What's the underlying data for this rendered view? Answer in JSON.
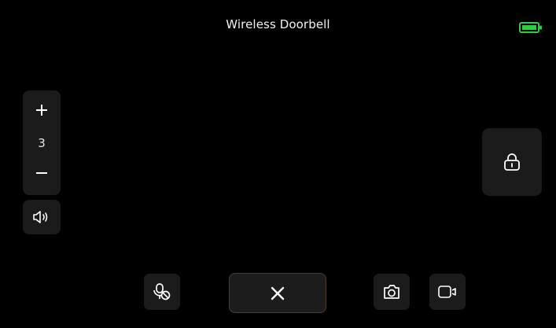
{
  "header": {
    "title": "Wireless Doorbell",
    "battery_icon": "battery-full-icon",
    "battery_color": "#2ecc40"
  },
  "volume": {
    "value": "3",
    "increase_icon": "plus-icon",
    "decrease_icon": "minus-icon"
  },
  "controls": {
    "speaker_icon": "speaker-icon",
    "lock_icon": "unlock-icon",
    "mute_icon": "mic-muted-icon",
    "hangup_icon": "close-icon",
    "snapshot_icon": "camera-icon",
    "record_icon": "video-icon"
  },
  "colors": {
    "background": "#000000",
    "button_bg": "#1b1b1b",
    "hangup_border": "#4b3d27"
  }
}
